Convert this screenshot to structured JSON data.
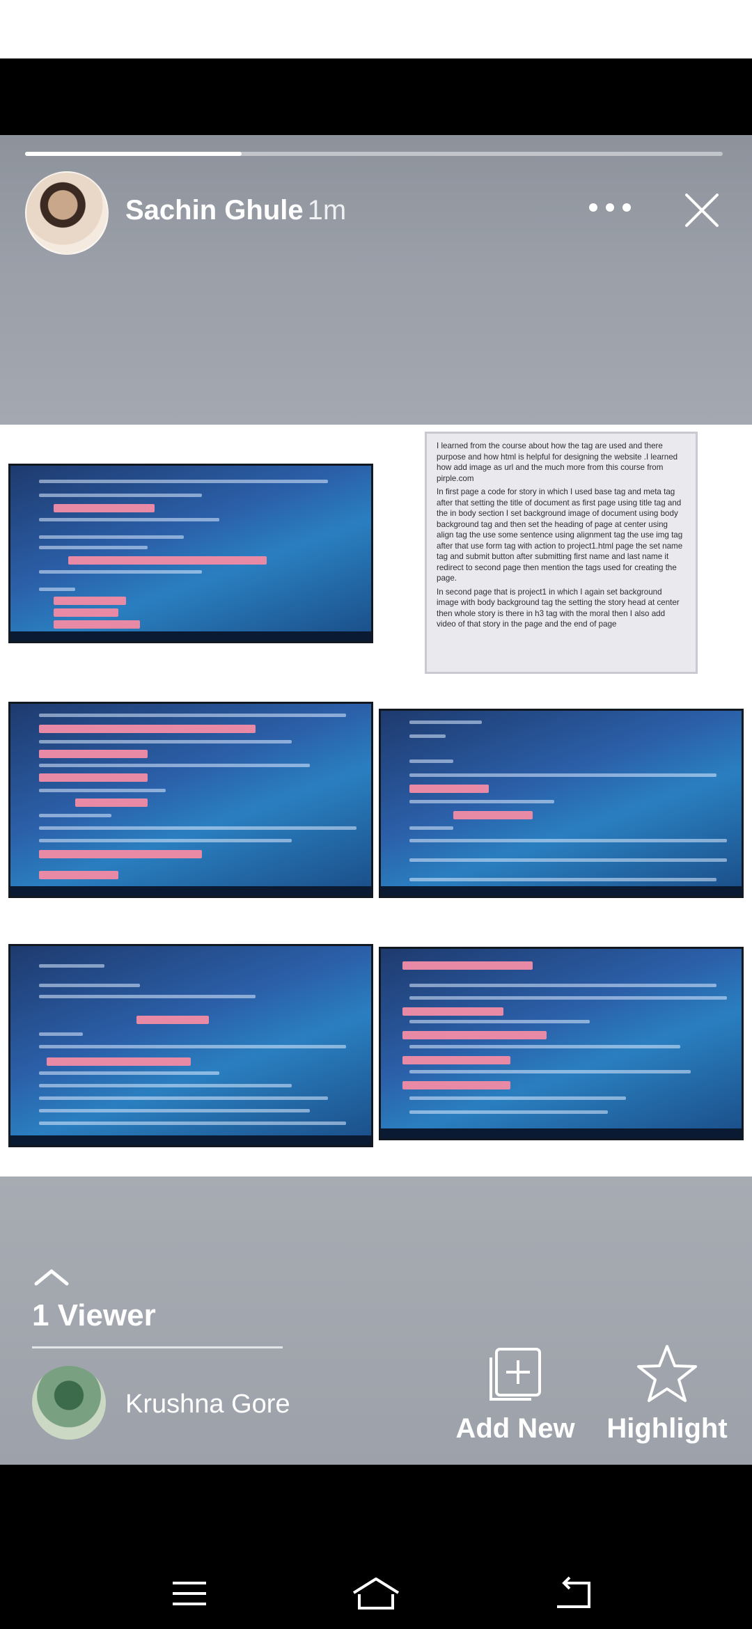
{
  "story": {
    "author_name": "Sachin Ghule",
    "time_ago": "1m",
    "progress_percent": 31
  },
  "icons": {
    "more": "more-dots-icon",
    "close": "close-icon",
    "chevron": "chevron-up-icon",
    "add_new": "add-new-icon",
    "highlight": "star-icon",
    "nav_menu": "menu-icon",
    "nav_home": "home-icon",
    "nav_back": "back-icon"
  },
  "document_text": {
    "p1": "I learned from the course about how the tag are used and there purpose and how html is helpful for designing the website .I learned how add image as url and the much more from this course from pirple.com",
    "p2": "In first page a code for story in which I used base tag and meta tag after that setting the title of document as first page using title tag and the in body section I set background image of document using body background tag and then set the heading of page at center using align tag the use some sentence using alignment tag the use img tag after that use form tag with action to project1.html page the set name tag and submit button after submitting first name and last name it redirect to second page then mention the tags used for creating the page.",
    "p3": "In second page that is project1 in which I again set background image with body background tag the setting the story head at center then whole story is there in h3 tag with the moral then I also add video of that story in the page and the end of page"
  },
  "viewers": {
    "count_label": "1 Viewer",
    "list": [
      {
        "name": "Krushna Gore"
      }
    ]
  },
  "actions": {
    "add_new_label": "Add New",
    "highlight_label": "Highlight"
  },
  "colors": {
    "header_bg": "#9a9fa8",
    "code_highlight": "#e889a6",
    "code_bg": "#2b5fa8"
  }
}
